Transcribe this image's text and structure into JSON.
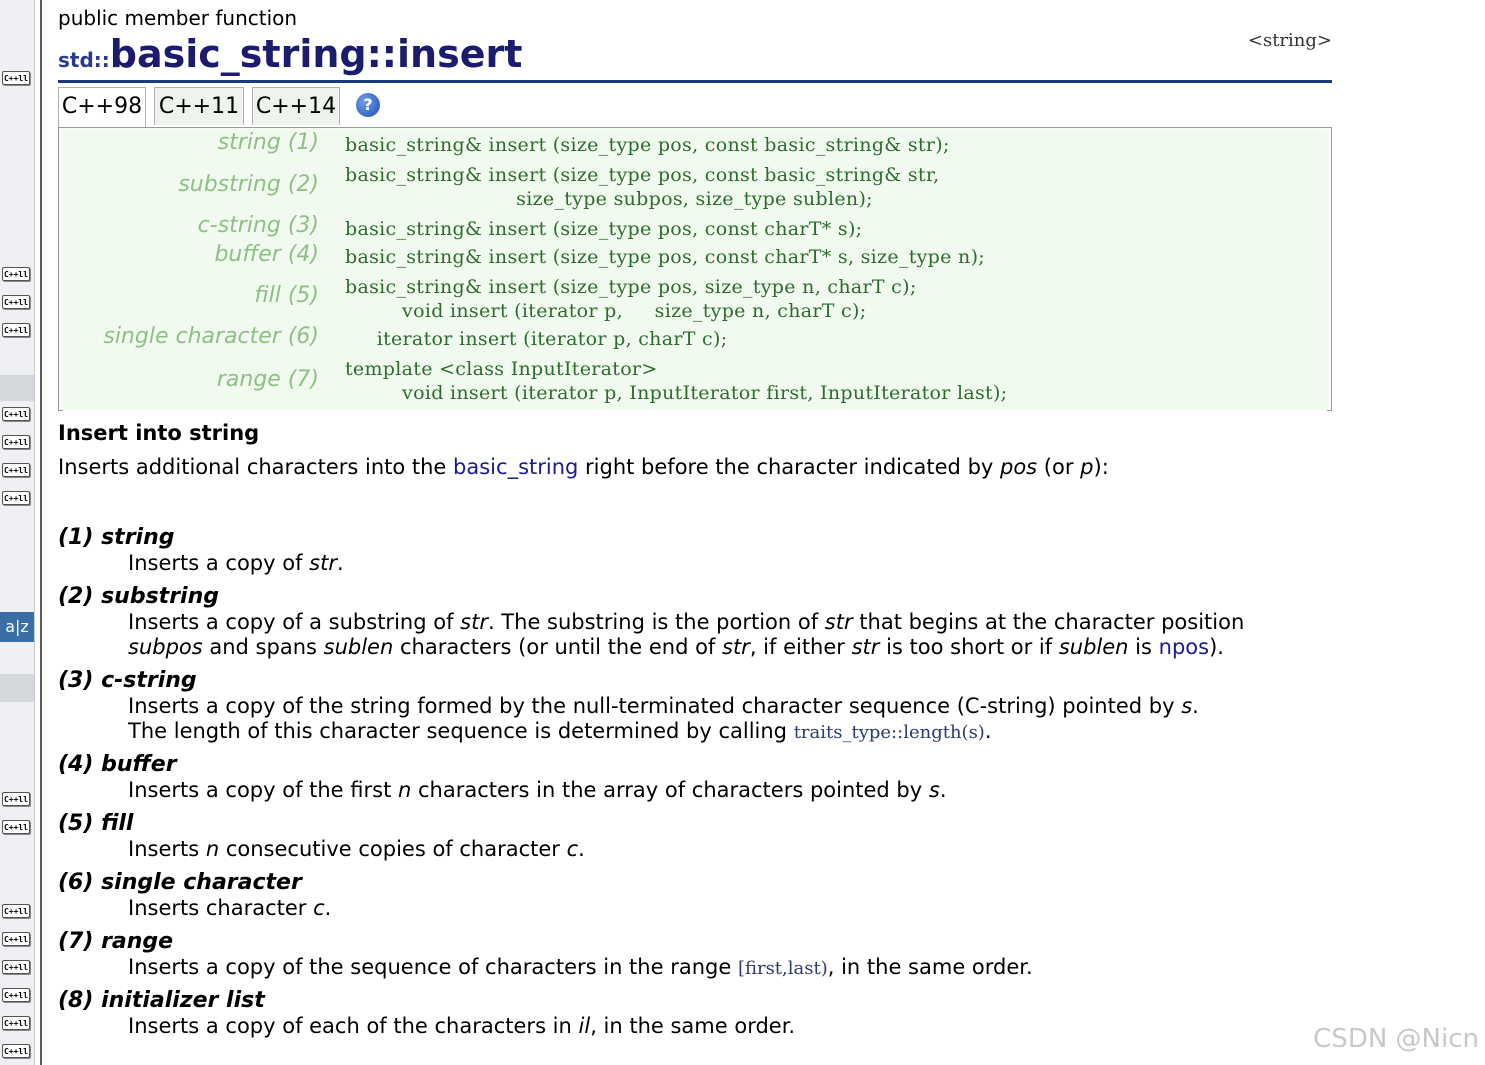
{
  "kind": "public member function",
  "title": {
    "ns": "std::",
    "name": "basic_string",
    "sep": "::",
    "member": "insert"
  },
  "header_file": "<string>",
  "tabs": [
    "C++98",
    "C++11",
    "C++14"
  ],
  "help_icon": "?",
  "sidebar": {
    "badge_label": "C++ll",
    "book_icon": "a|z"
  },
  "prototypes": [
    {
      "label": "string (1)",
      "code": "basic_string& insert (size_type pos, const basic_string& str);"
    },
    {
      "label": "substring (2)",
      "code": "basic_string& insert (size_type pos, const basic_string& str,\n                           size_type subpos, size_type sublen);"
    },
    {
      "label": "c-string (3)",
      "code": "basic_string& insert (size_type pos, const charT* s);"
    },
    {
      "label": "buffer (4)",
      "code": "basic_string& insert (size_type pos, const charT* s, size_type n);"
    },
    {
      "label": "fill (5)",
      "code": "basic_string& insert (size_type pos, size_type n, charT c);\n         void insert (iterator p,     size_type n, charT c);"
    },
    {
      "label": "single character (6)",
      "code": "     iterator insert (iterator p, charT c);"
    },
    {
      "label": "range (7)",
      "code": "template <class InputIterator>\n         void insert (iterator p, InputIterator first, InputIterator last);"
    }
  ],
  "section_title": "Insert into string",
  "intro": {
    "pre": "Inserts additional characters into the ",
    "link": "basic_string",
    "mid": " right before the character indicated by ",
    "pos": "pos",
    "or": " (or ",
    "p": "p",
    "end": "):"
  },
  "items": [
    {
      "head": "(1) string",
      "desc": "Inserts a copy of <i>str</i>."
    },
    {
      "head": "(2) substring",
      "desc": "Inserts a copy of a substring of <i>str</i>. The substring is the portion of <i>str</i> that begins at the character position<br><i>subpos</i> and spans <i>sublen</i> characters (or until the end of <i>str</i>, if either <i>str</i> is too short or if <i>sublen</i> is <span class=\"link\">npos</span>)."
    },
    {
      "head": "(3) c-string",
      "desc": "Inserts a copy of the string formed by the null-terminated character sequence (C-string) pointed by <i>s</i>.<br>The length of this character sequence is determined by calling <span class=\"code-inline\">traits_type::length(s)</span>."
    },
    {
      "head": "(4) buffer",
      "desc": "Inserts a copy of the first <i>n</i> characters in the array of characters pointed by <i>s</i>."
    },
    {
      "head": "(5) fill",
      "desc": "Inserts <i>n</i> consecutive copies of character <i>c</i>."
    },
    {
      "head": "(6) single character",
      "desc": "Inserts character <i>c</i>."
    },
    {
      "head": "(7) range",
      "desc": "Inserts a copy of the sequence of characters in the range <span class=\"code-inline\">[first,last)</span>, in the same order."
    },
    {
      "head": "(8) initializer list",
      "desc": "Inserts a copy of each of the characters in <i>il</i>, in the same order."
    }
  ],
  "watermark": "CSDN @Nicn"
}
